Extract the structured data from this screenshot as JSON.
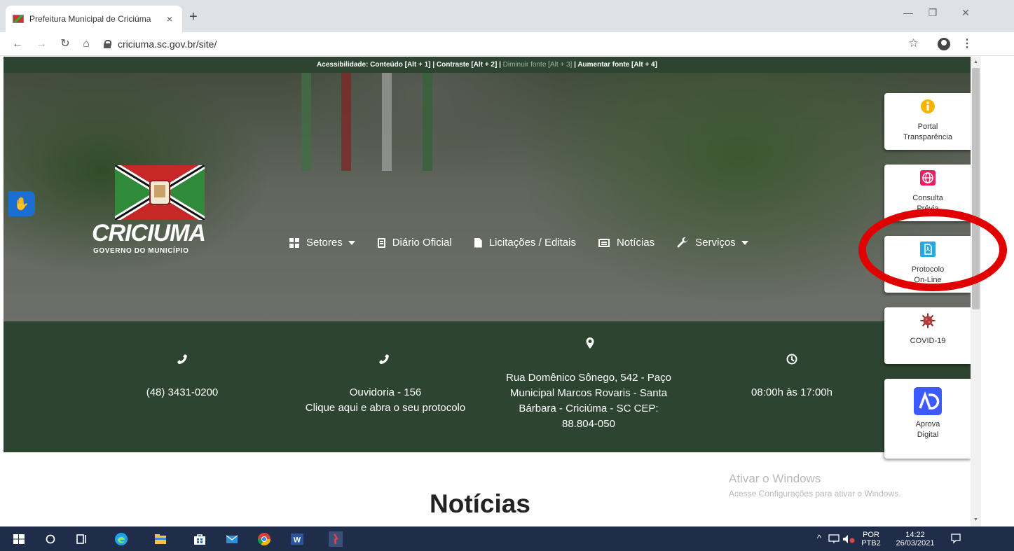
{
  "browser": {
    "tab_title": "Prefeitura Municipal de Criciúma",
    "tab_close": "×",
    "new_tab": "+",
    "url": "criciuma.sc.gov.br/site/",
    "win_min": "—",
    "win_max": "❐",
    "win_close": "✕"
  },
  "accessibility": {
    "prefix": "Acessibilidade: Conteúdo [Alt + 1] | Contraste [Alt + 2] |",
    "dim": " Diminuir fonte [Alt + 3]",
    "suffix": " | Aumentar fonte [Alt + 4]"
  },
  "logo": {
    "word": "CRICIUMA",
    "sub": "GOVERNO DO MUNICÍPIO"
  },
  "nav": {
    "setores": "Setores",
    "diario": "Diário Oficial",
    "licitacoes": "Licitações / Editais",
    "noticias": "Notícias",
    "servicos": "Serviços"
  },
  "contact": {
    "phone": "(48) 3431-0200",
    "ouvidoria_1": "Ouvidoria - 156",
    "ouvidoria_2": "Clique aqui e abra o seu protocolo",
    "address_1": "Rua Domênico Sônego, 542 - Paço",
    "address_2": "Municipal Marcos Rovaris - Santa",
    "address_3": "Bárbara - Criciúma - SC CEP:",
    "address_4": "88.804-050",
    "hours": "08:00h às 17:00h"
  },
  "section_title": "Notícias",
  "side": {
    "transparencia_1": "Portal",
    "transparencia_2": "Transparência",
    "consulta_1": "Consulta",
    "consulta_2": "Prévia",
    "protocolo_1": "Protocolo",
    "protocolo_2": "On-Line",
    "covid": "COVID-19",
    "aprova_1": "Aprova",
    "aprova_2": "Digital"
  },
  "watermark": {
    "line1": "Ativar o Windows",
    "line2": "Acesse Configurações para ativar o Windows."
  },
  "tray": {
    "lang_1": "POR",
    "lang_2": "PTB2",
    "time": "14:22",
    "date": "26/03/2021"
  },
  "colors": {
    "site_green": "#2d4530",
    "ring_red": "#e00000",
    "taskbar": "#1f2d4a"
  }
}
